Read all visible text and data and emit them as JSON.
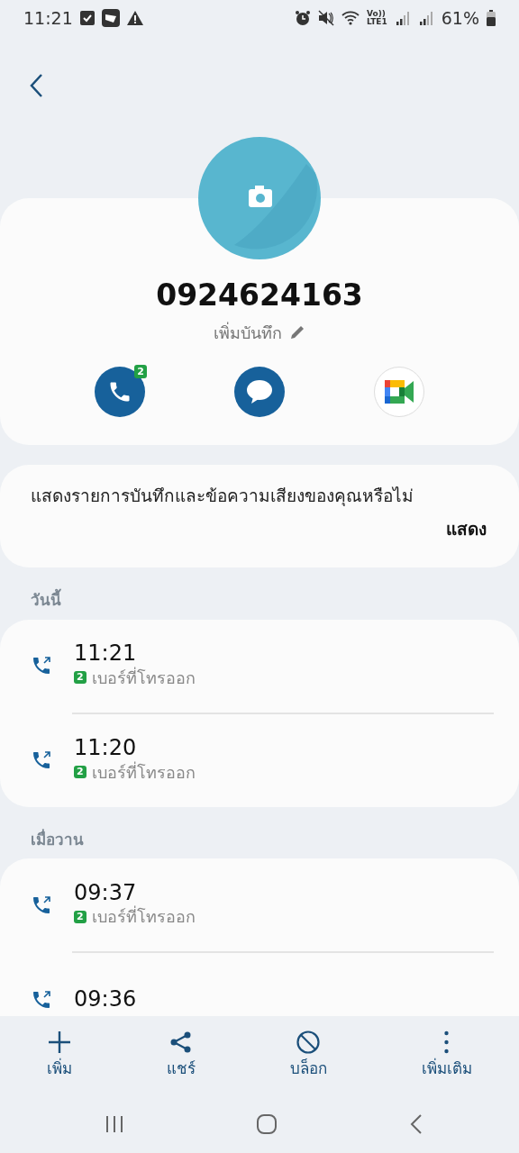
{
  "status_bar": {
    "time": "11:21",
    "network": [
      "Vo))",
      "LTE1"
    ],
    "battery": "61%"
  },
  "contact": {
    "number": "0924624163",
    "note_link": "เพิ่มบันทึก",
    "call_sim_badge": "2"
  },
  "prompt": {
    "text": "แสดงรายการบันทึกและข้อความเสียงของคุณหรือไม่",
    "action": "แสดง"
  },
  "sections": [
    {
      "label": "วันนี้",
      "calls": [
        {
          "time": "11:21",
          "sim": "2",
          "type": "เบอร์ที่โทรออก"
        },
        {
          "time": "11:20",
          "sim": "2",
          "type": "เบอร์ที่โทรออก"
        }
      ]
    },
    {
      "label": "เมื่อวาน",
      "calls": [
        {
          "time": "09:37",
          "sim": "2",
          "type": "เบอร์ที่โทรออก"
        },
        {
          "time": "09:36"
        }
      ]
    }
  ],
  "bottom_actions": [
    {
      "kind": "add",
      "label": "เพิ่ม"
    },
    {
      "kind": "share",
      "label": "แชร์"
    },
    {
      "kind": "block",
      "label": "บล็อก"
    },
    {
      "kind": "more",
      "label": "เพิ่มเติม"
    }
  ]
}
